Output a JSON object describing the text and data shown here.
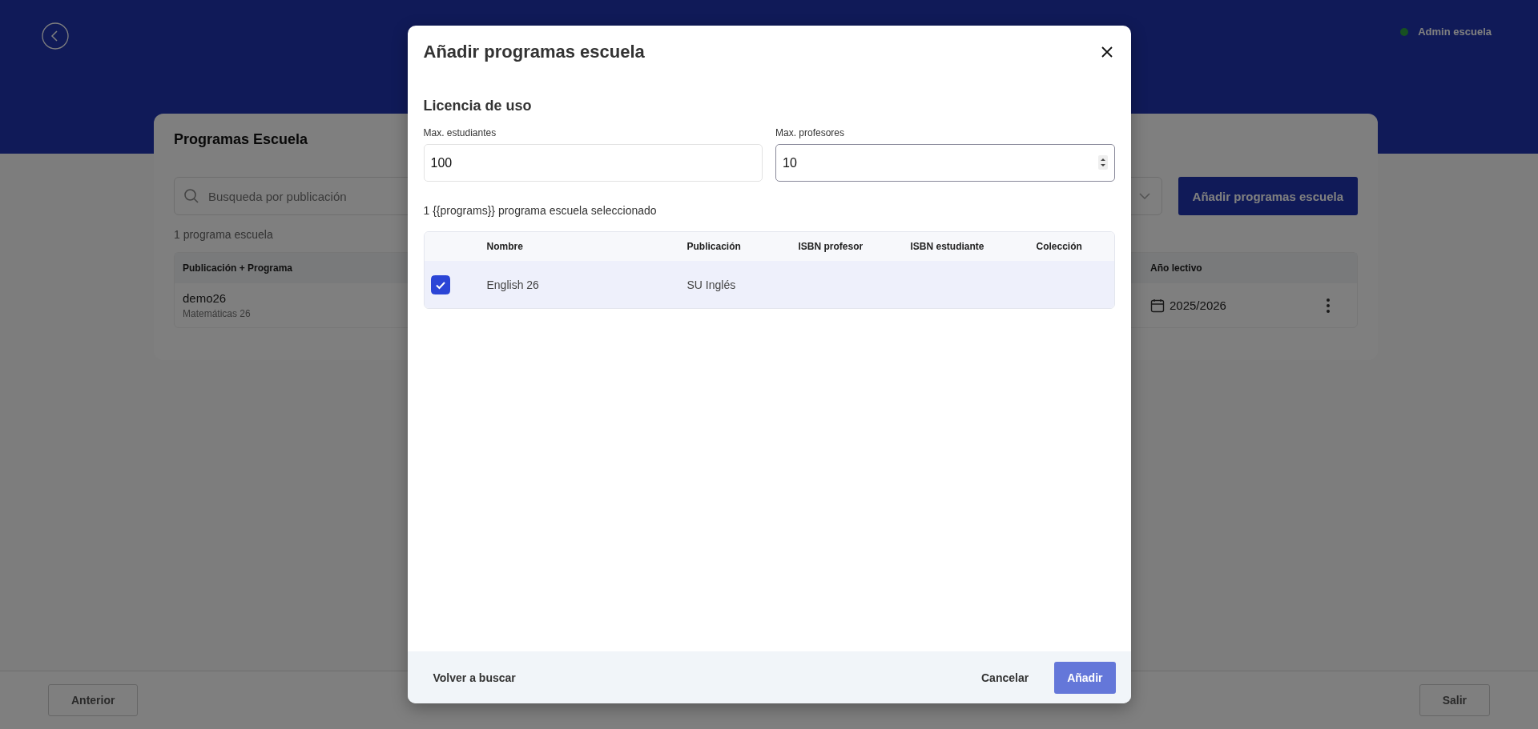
{
  "header": {
    "user": "Admin escuela"
  },
  "card": {
    "title": "Programas Escuela",
    "search": {
      "placeholder": "Busqueda por publicación"
    },
    "add_button": "Añadir programas escuela",
    "count": "1 programa escuela",
    "table": {
      "columns": [
        "Publicación + Programa",
        "Año lectivo"
      ],
      "rows": [
        {
          "name": "demo26",
          "program": "Matemáticas 26",
          "year": "2025/2026"
        }
      ]
    }
  },
  "footer": {
    "back": "Anterior",
    "exit": "Salir"
  },
  "modal": {
    "title": "Añadir programas escuela",
    "section": "Licencia de uso",
    "fields": [
      {
        "label": "Max. estudiantes",
        "value": "100",
        "kind": "text"
      },
      {
        "label": "Max. profesores",
        "value": "10",
        "kind": "number"
      }
    ],
    "selection": "1 {{programs}} programa escuela seleccionado",
    "table": {
      "columns": [
        "Nombre",
        "Publicación",
        "ISBN profesor",
        "ISBN estudiante",
        "Colección"
      ],
      "rows": [
        {
          "selected": true,
          "cells": [
            "English 26",
            "SU Inglés"
          ]
        }
      ]
    },
    "buttons": {
      "back": "Volver a buscar",
      "cancel": "Cancelar",
      "submit": "Añadir"
    }
  }
}
